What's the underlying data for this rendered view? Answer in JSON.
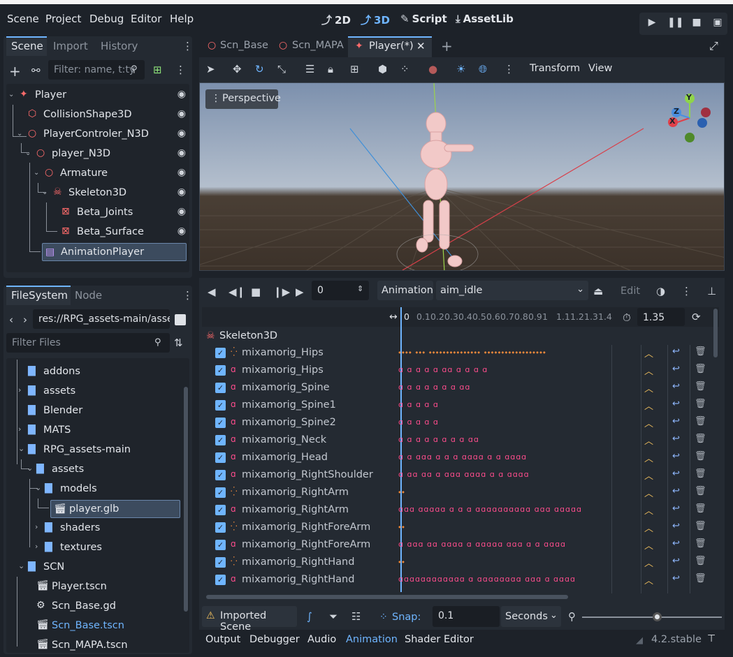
{
  "menubar": {
    "items": [
      "Scene",
      "Project",
      "Debug",
      "Editor",
      "Help"
    ],
    "workspaces": [
      "2D",
      "3D",
      "Script",
      "AssetLib"
    ]
  },
  "scene_dock": {
    "tabs": [
      "Scene",
      "Import",
      "History"
    ],
    "filter_placeholder": "Filter: name, t:ty",
    "nodes": [
      {
        "label": "Player"
      },
      {
        "label": "CollisionShape3D"
      },
      {
        "label": "PlayerControler_N3D"
      },
      {
        "label": "player_N3D"
      },
      {
        "label": "Armature"
      },
      {
        "label": "Skeleton3D"
      },
      {
        "label": "Beta_Joints"
      },
      {
        "label": "Beta_Surface"
      },
      {
        "label": "AnimationPlayer"
      }
    ]
  },
  "filesystem_dock": {
    "tabs": [
      "FileSystem",
      "Node"
    ],
    "path": "res://RPG_assets-main/asse",
    "filter_placeholder": "Filter Files",
    "items": [
      {
        "label": "addons"
      },
      {
        "label": "assets"
      },
      {
        "label": "Blender"
      },
      {
        "label": "MATS"
      },
      {
        "label": "RPG_assets-main"
      },
      {
        "label": "assets"
      },
      {
        "label": "models"
      },
      {
        "label": "player.glb"
      },
      {
        "label": "shaders"
      },
      {
        "label": "textures"
      },
      {
        "label": "SCN"
      },
      {
        "label": "Player.tscn"
      },
      {
        "label": "Scn_Base.gd"
      },
      {
        "label": "Scn_Base.tscn"
      },
      {
        "label": "Scn_MAPA.tscn"
      }
    ]
  },
  "scene_tabs": [
    "Scn_Base",
    "Scn_MAPA",
    "Player(*)"
  ],
  "toolbar_3d": {
    "transform": "Transform",
    "view": "View"
  },
  "viewport": {
    "perspective_label": "Perspective",
    "gizmo": {
      "x": "X",
      "y": "Y",
      "z": "Z"
    }
  },
  "animation": {
    "time_value": "0",
    "animation_label": "Animation",
    "selected_animation": "aim_idle",
    "edit_label": "Edit",
    "ruler": [
      "0",
      "0.1",
      "0.2",
      "0.3",
      "0.4",
      "0.5",
      "0.6",
      "0.7",
      "0.8",
      "0.9",
      "1",
      "1.1",
      "1.2",
      "1.3",
      "1.4"
    ],
    "length": "1.35",
    "root": "Skeleton3D",
    "tracks": [
      {
        "name": "mixamorig_Hips",
        "type": "pos",
        "keys": "⬩⬩⬩⬩ ⬩⬩⬩ ⬩⬩⬩⬩⬩⬩⬩⬩⬩⬩⬩⬩⬩⬩⬩ ⬩⬩⬩⬩⬩⬩⬩⬩⬩⬩⬩⬩⬩⬩⬩⬩⬩⬩"
      },
      {
        "name": "mixamorig_Hips",
        "type": "rot",
        "keys": "ɑ     ɑ   ɑ  ɑ    ɑ  ɑɑ  ɑ   ɑ    ɑ    ɑ"
      },
      {
        "name": "mixamorig_Spine",
        "type": "rot",
        "keys": "ɑ   ɑ    ɑ          ɑ    ɑ    ɑ    ɑ      ɑɑ"
      },
      {
        "name": "mixamorig_Spine1",
        "type": "rot",
        "keys": "ɑ        ɑ         ɑ    ɑ              ɑ"
      },
      {
        "name": "mixamorig_Spine2",
        "type": "rot",
        "keys": "ɑ          ɑ          ɑ        ɑ          ɑ"
      },
      {
        "name": "mixamorig_Neck",
        "type": "rot",
        "keys": "ɑ  ɑ  ɑ   ɑ         ɑ  ɑ   ɑ    ɑ      ɑɑ"
      },
      {
        "name": "mixamorig_Head",
        "type": "rot",
        "keys": "ɑ ɑ    ɑɑɑ  ɑ      ɑ   ɑ  ɑɑɑɑ   ɑ ɑ ɑɑɑɑ"
      },
      {
        "name": "mixamorig_RightShoulder",
        "type": "rot",
        "keys": "ɑ ɑɑ ɑɑ ɑ   ɑɑɑ ɑɑɑɑ  ɑ    ɑ      ɑɑɑɑ"
      },
      {
        "name": "mixamorig_RightArm",
        "type": "pos",
        "keys": "⬩⬩"
      },
      {
        "name": "mixamorig_RightArm",
        "type": "rot",
        "keys": "ɑɑɑ ɑɑɑɑɑ ɑ ɑ ɑ   ɑɑɑɑɑɑɑɑɑɑ  ɑɑɑ ɑɑɑɑɑ"
      },
      {
        "name": "mixamorig_RightForeArm",
        "type": "pos",
        "keys": "⬩⬩"
      },
      {
        "name": "mixamorig_RightForeArm",
        "type": "rot",
        "keys": "ɑ  ɑɑɑ ɑɑ ɑɑɑɑ ɑ  ɑɑɑɑɑ ɑɑɑ   ɑ     ɑ ɑɑɑɑ"
      },
      {
        "name": "mixamorig_RightHand",
        "type": "pos",
        "keys": "⬩⬩"
      },
      {
        "name": "mixamorig_RightHand",
        "type": "rot",
        "keys": "ɑɑɑɑɑɑɑɑɑɑɑɑ ɑ ɑɑɑɑɑɑɑɑ ɑɑɑ ɑ   ɑɑɑɑ"
      }
    ]
  },
  "anim_bottom": {
    "imported_scene": "Imported Scene",
    "snap_label": "Snap:",
    "snap_value": "0.1",
    "snap_unit": "Seconds"
  },
  "bottom_tabs": [
    "Output",
    "Debugger",
    "Audio",
    "Animation",
    "Shader Editor"
  ],
  "version": "4.2.stable",
  "colors": {
    "accent": "#6fb5ff",
    "track_rot": "#ff4d8d",
    "track_pos": "#f08a3c",
    "scene_node": "#ff6b6b"
  }
}
